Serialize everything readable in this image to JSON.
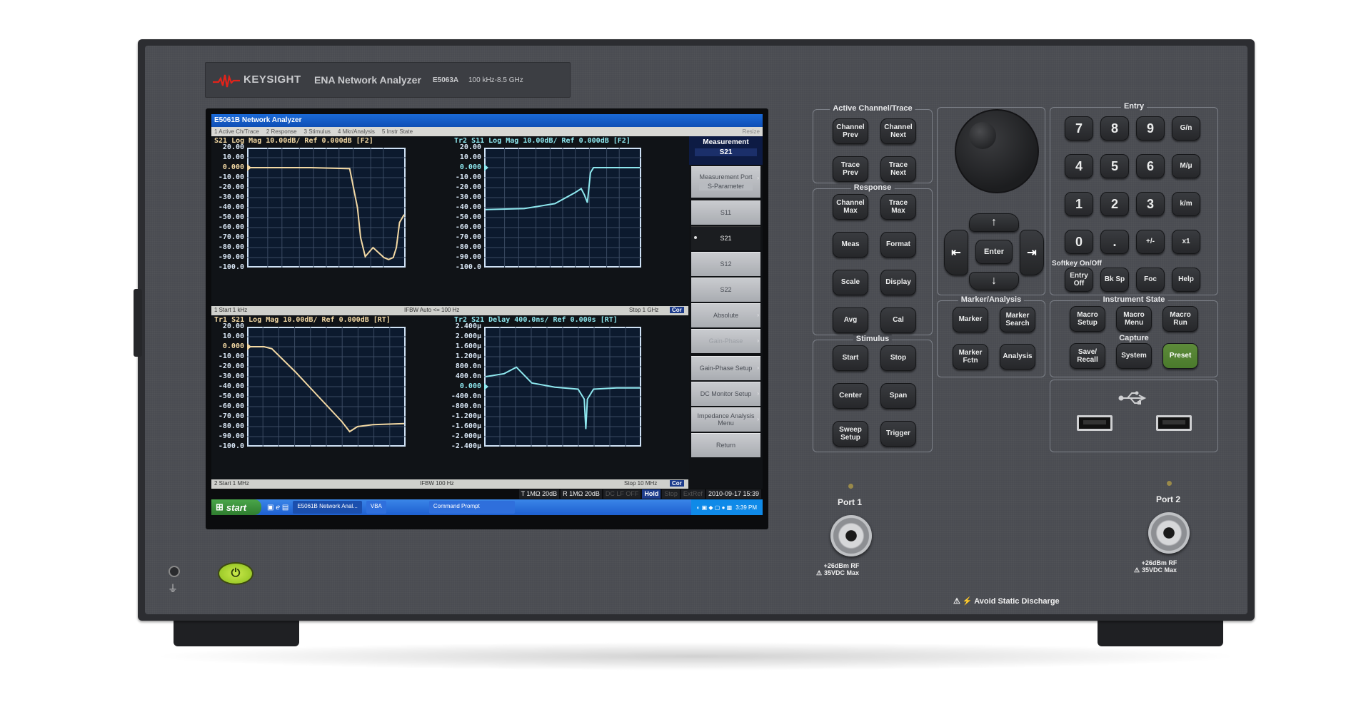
{
  "header": {
    "brand": "KEYSIGHT",
    "model_name": "ENA Network Analyzer",
    "model_number": "E5063A",
    "frequency_range": "100 kHz-8.5 GHz",
    "brand_color": "#e2231a"
  },
  "screen": {
    "window_title": "E5061B Network Analyzer",
    "menu": [
      "1 Active Ch/Trace",
      "2 Response",
      "3 Stimulus",
      "4 Mkr/Analysis",
      "5 Instr State"
    ],
    "resize_label": "Resize",
    "softkeys": {
      "header_label": "Measurement",
      "header_value": "S21",
      "items": [
        {
          "label": "Measurement Port",
          "sub": "S-Parameter",
          "arrow": true,
          "state": "normal"
        },
        {
          "label": "S11",
          "state": "normal"
        },
        {
          "label": "S21",
          "state": "active"
        },
        {
          "label": "S12",
          "state": "normal"
        },
        {
          "label": "S22",
          "state": "normal"
        },
        {
          "label": "Absolute",
          "arrow": true,
          "state": "normal"
        },
        {
          "label": "Gain-Phase",
          "arrow": true,
          "state": "dim"
        },
        {
          "label": "Gain-Phase Setup",
          "arrow": true,
          "state": "normal"
        },
        {
          "label": "DC Monitor Setup",
          "arrow": true,
          "state": "normal"
        },
        {
          "label": "Impedance Analysis Menu",
          "arrow": true,
          "state": "normal"
        },
        {
          "label": "Return",
          "state": "normal"
        }
      ]
    },
    "channel1_status": {
      "left": "1 Start 1 kHz",
      "center": "IFBW Auto <= 100 Hz",
      "right": "Stop 1 GHz",
      "cor": "Cor"
    },
    "channel2_status": {
      "left": "2 Start 1 MHz",
      "center": "IFBW 100 Hz",
      "right": "Stop 10 MHz",
      "cor": "Cor"
    },
    "info_bar": [
      {
        "text": "T 1MΩ 20dB",
        "state": "on"
      },
      {
        "text": "R 1MΩ 20dB",
        "state": "on"
      },
      {
        "text": "DC LF OFF",
        "state": "off"
      },
      {
        "text": "Hold",
        "state": "hold"
      },
      {
        "text": "Stop",
        "state": "off"
      },
      {
        "text": "ExtRef",
        "state": "off"
      },
      {
        "text": "2010-09-17 15:39",
        "state": "on"
      }
    ],
    "taskbar": {
      "start_label": "start",
      "items": [
        "E5061B Network Anal...",
        "VBA",
        "Command Prompt"
      ],
      "clock": "3:39 PM"
    }
  },
  "chart_data": [
    {
      "type": "line",
      "title": "S21 Log Mag 10.00dB/ Ref 0.000dB [F2]",
      "trace_label": "Tr1",
      "color": "#f3d9a4",
      "ylabel": "dB",
      "yticks": [
        "20.00",
        "10.00",
        "0.000",
        "-10.00",
        "-20.00",
        "-30.00",
        "-40.00",
        "-50.00",
        "-60.00",
        "-70.00",
        "-80.00",
        "-90.00",
        "-100.0"
      ],
      "ylim": [
        -100,
        20
      ],
      "xlim": [
        0,
        1
      ],
      "x": [
        0,
        0.05,
        0.4,
        0.65,
        0.7,
        0.72,
        0.75,
        0.8,
        0.87,
        0.9,
        0.93,
        0.95,
        0.97,
        1.0
      ],
      "y": [
        0,
        0,
        0,
        -1,
        -40,
        -70,
        -89,
        -80,
        -90,
        -92,
        -90,
        -80,
        -55,
        -47
      ],
      "grid": true
    },
    {
      "type": "line",
      "title": "Tr2 S11 Log Mag 10.00dB/ Ref 0.000dB [F2]",
      "color": "#8ee8ef",
      "ylabel": "dB",
      "yticks": [
        "20.00",
        "10.00",
        "0.000",
        "-10.00",
        "-20.00",
        "-30.00",
        "-40.00",
        "-50.00",
        "-60.00",
        "-70.00",
        "-80.00",
        "-90.00",
        "-100.0"
      ],
      "ylim": [
        -100,
        20
      ],
      "xlim": [
        0,
        1
      ],
      "x": [
        0,
        0.25,
        0.45,
        0.58,
        0.62,
        0.64,
        0.66,
        0.68,
        0.7,
        0.75,
        0.85,
        1.0
      ],
      "y": [
        -42,
        -41,
        -36,
        -25,
        -21,
        -27,
        -35,
        -5,
        0,
        0,
        0,
        0
      ],
      "grid": true
    },
    {
      "type": "line",
      "title": "Tr1 S21 Log Mag 10.00dB/ Ref 0.000dB [RT]",
      "color": "#f3d9a4",
      "ylabel": "dB",
      "yticks": [
        "20.00",
        "10.00",
        "0.000",
        "-10.00",
        "-20.00",
        "-30.00",
        "-40.00",
        "-50.00",
        "-60.00",
        "-70.00",
        "-80.00",
        "-90.00",
        "-100.0"
      ],
      "ylim": [
        -100,
        20
      ],
      "xlim": [
        0,
        1
      ],
      "x": [
        0,
        0.1,
        0.15,
        0.3,
        0.45,
        0.6,
        0.65,
        0.7,
        0.8,
        1.0
      ],
      "y": [
        0,
        0,
        -2,
        -25,
        -50,
        -75,
        -85,
        -80,
        -78,
        -77
      ],
      "grid": true
    },
    {
      "type": "line",
      "title": "Tr2 S21 Delay 400.0ns/ Ref 0.000s [RT]",
      "color": "#8ee8ef",
      "ylabel": "s",
      "yticks": [
        "2.400μ",
        "2.000μ",
        "1.600μ",
        "1.200μ",
        "800.0n",
        "400.0n",
        "0.000",
        "-400.0n",
        "-800.0n",
        "-1.200μ",
        "-1.600μ",
        "-2.000μ",
        "-2.400μ"
      ],
      "ylim": [
        -2.4,
        2.4
      ],
      "xlim": [
        0,
        1
      ],
      "x": [
        0,
        0.12,
        0.2,
        0.3,
        0.45,
        0.6,
        0.64,
        0.65,
        0.66,
        0.7,
        0.85,
        1.0
      ],
      "y": [
        0.4,
        0.52,
        0.78,
        0.15,
        -0.02,
        -0.1,
        -0.5,
        -1.7,
        -0.5,
        -0.1,
        -0.05,
        -0.05
      ],
      "y_unit_scale": "μs",
      "grid": true
    }
  ],
  "panel": {
    "groups": {
      "active": "Active Channel/Trace",
      "response": "Response",
      "stimulus": "Stimulus",
      "marker": "Marker/Analysis",
      "entry": "Entry",
      "instr": "Instrument State",
      "capture": "Capture",
      "softkey": "Softkey On/Off"
    },
    "keys": {
      "ch_prev": "Channel Prev",
      "ch_next": "Channel Next",
      "tr_prev": "Trace Prev",
      "tr_next": "Trace Next",
      "ch_max": "Channel Max",
      "tr_max": "Trace Max",
      "meas": "Meas",
      "format": "Format",
      "scale": "Scale",
      "display": "Display",
      "avg": "Avg",
      "cal": "Cal",
      "start": "Start",
      "stop": "Stop",
      "center": "Center",
      "span": "Span",
      "sweep": "Sweep Setup",
      "trigger": "Trigger",
      "marker": "Marker",
      "marker_search": "Marker Search",
      "marker_fctn": "Marker Fctn",
      "analysis": "Analysis",
      "enter": "Enter",
      "up": "↑",
      "down": "↓",
      "left": "⇤",
      "right": "⇥",
      "n7": "7",
      "n8": "8",
      "n9": "9",
      "gn": "G/n",
      "n4": "4",
      "n5": "5",
      "n6": "6",
      "mu": "M/μ",
      "n1": "1",
      "n2": "2",
      "n3": "3",
      "km": "k/m",
      "n0": "0",
      "dot": ".",
      "pm": "+/-",
      "x1": "x1",
      "entry_off": "Entry Off",
      "bksp": "Bk Sp",
      "foc": "Foc",
      "help": "Help",
      "macro_setup": "Macro Setup",
      "macro_menu": "Macro Menu",
      "macro_run": "Macro Run",
      "save_recall": "Save/ Recall",
      "system": "System",
      "preset": "Preset"
    },
    "ports": [
      {
        "label": "Port 1",
        "warning": "+26dBm RF\n35VDC Max"
      },
      {
        "label": "Port 2",
        "warning": "+26dBm RF\n35VDC Max"
      }
    ],
    "static_warning": "Avoid Static Discharge",
    "preset_color": "#5d8b3a",
    "power_color": "#b5dc34"
  }
}
